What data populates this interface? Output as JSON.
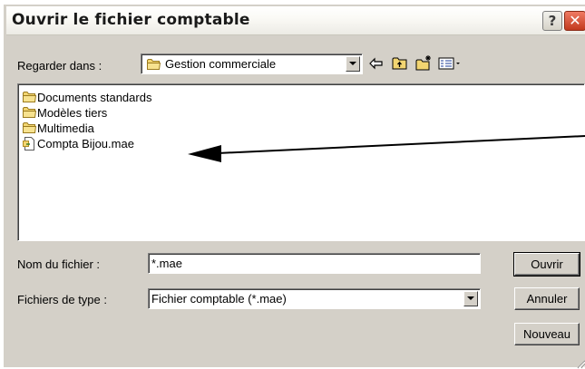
{
  "window": {
    "title": "Ouvrir le fichier comptable",
    "help_label": "?",
    "close_label": "✕"
  },
  "look_in": {
    "label": "Regarder dans :",
    "value": "Gestion commerciale"
  },
  "toolbar": {
    "icons": [
      "back-arrow-icon",
      "up-folder-icon",
      "new-folder-icon",
      "view-menu-icon"
    ]
  },
  "files": [
    {
      "name": "Documents standards",
      "type": "folder"
    },
    {
      "name": "Modèles tiers",
      "type": "folder"
    },
    {
      "name": "Multimedia",
      "type": "folder"
    },
    {
      "name": "Compta Bijou.mae",
      "type": "file"
    }
  ],
  "filename": {
    "label": "Nom du fichier :",
    "value": "*.mae"
  },
  "filetype": {
    "label": "Fichiers de type :",
    "value": "Fichier comptable (*.mae)"
  },
  "buttons": {
    "open": "Ouvrir",
    "cancel": "Annuler",
    "new": "Nouveau"
  },
  "colors": {
    "dialog_bg": "#d4d0c8",
    "folder": "#f2d571",
    "close": "#c23a1f"
  }
}
